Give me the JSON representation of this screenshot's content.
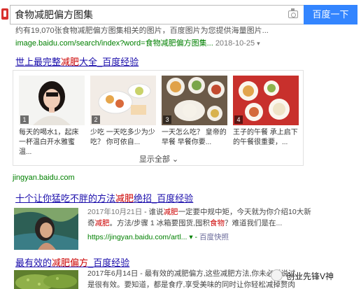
{
  "search": {
    "query": "食物减肥偏方图集",
    "button_label": "百度一下"
  },
  "result1": {
    "cut_text": "约有19,070张食物减肥偏方图集相关的图片，百度图片为您提供海量图片...",
    "url": "image.baidu.com/search/index?word=食物减肥偏方图集...",
    "date": "2018-10-25"
  },
  "result2": {
    "title_a": "世上最完整",
    "title_hl": "减肥",
    "title_b": "大全_百度经验",
    "items": [
      {
        "num": "1",
        "caption": "每天的喝水1，起床一杯温白开水雅蜜温..."
      },
      {
        "num": "2",
        "caption": "少吃 一天吃多少为少吃？ 你可依自..."
      },
      {
        "num": "3",
        "caption": "一天怎么吃？ 皇帝的早餐 早餐你要..."
      },
      {
        "num": "4",
        "caption": "王子的午餐 承上启下的午餐很重要，..."
      }
    ],
    "show_all": "显示全部",
    "domain": "jingyan.baidu.com"
  },
  "result3": {
    "title_a": "十个让你猛吃不胖的方法",
    "title_hl": "减肥",
    "title_b": "绝招_百度经验",
    "line1_date": "2017年10月21日",
    "line1_a": " - 谁说",
    "line1_hl": "减肥",
    "line1_b": "一定要中规中矩，今天就为你介绍10大新",
    "line2_a": "奇",
    "line2_hl": "减肥",
    "line2_b": "。方法/步骤 1 冰箱要囤货,囤积",
    "line2_hl2": "食物",
    "line2_c": "？难道我们是在...",
    "url": "https://jingyan.baidu.com/artl...",
    "snapshot": "百度快照"
  },
  "result4": {
    "title_a": "最有效的",
    "title_hl": "减肥偏方",
    "title_b": "_百度经验",
    "line1": "2017年6月14日 - 最有效的减肥偏方,这些减肥方法,你未必听说过...",
    "line2": "是很有效。要知道，都是食疗,享受美味的同时让你轻松减掉赘肉"
  },
  "watermark": {
    "text": "创业先锋V神"
  },
  "colors": {
    "link": "#1a0dab",
    "highlight": "#cc0000",
    "url": "#008000",
    "button": "#3385ff"
  }
}
